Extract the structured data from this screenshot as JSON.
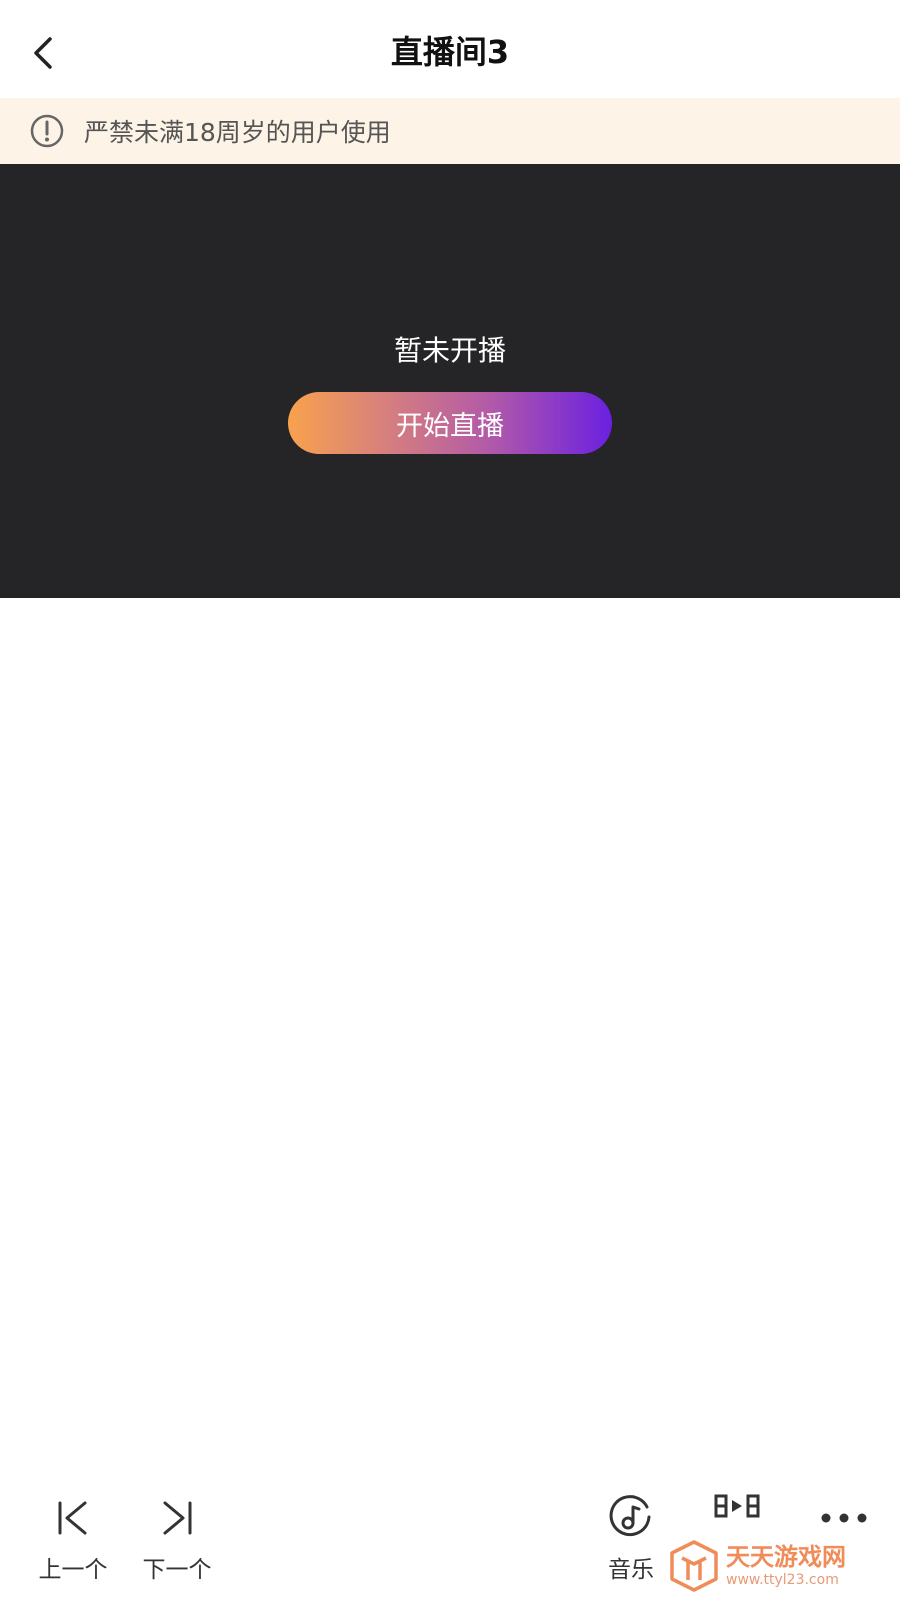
{
  "header": {
    "title": "直播间3",
    "back_icon": "chevron-left-icon"
  },
  "warning": {
    "icon": "info-circle-icon",
    "text": "严禁未满18周岁的用户使用"
  },
  "live": {
    "status_text": "暂未开播",
    "start_button_label": "开始直播",
    "gradient_colors": [
      "#f8a24d",
      "#6b20e0"
    ]
  },
  "toolbar": {
    "prev_label": "上一个",
    "next_label": "下一个",
    "music_label": "音乐",
    "video_icon": "video-clip-icon",
    "more_icon": "more-dots-icon"
  },
  "watermark": {
    "name": "天天游戏网",
    "url": "www.ttyl23.com"
  },
  "colors": {
    "banner_bg": "#fdf3e6",
    "live_bg": "#252426"
  }
}
